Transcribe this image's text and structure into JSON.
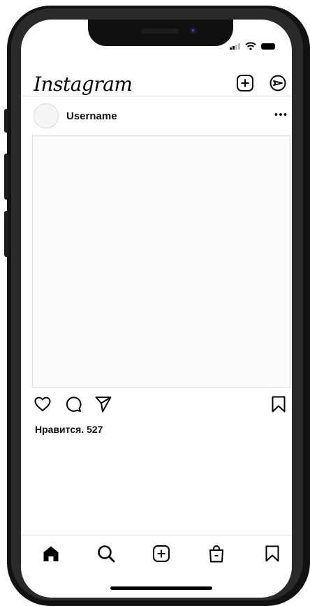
{
  "app": {
    "logo_text": "Instagram"
  },
  "header": {
    "icons": [
      "plus-square-icon",
      "direct-message-icon"
    ]
  },
  "post": {
    "username": "Username",
    "likes_text": "Нравится. 527"
  },
  "actions": {
    "icons": [
      "heart-icon",
      "comment-icon",
      "share-icon",
      "bookmark-icon"
    ]
  },
  "tabbar": {
    "items": [
      "home-icon",
      "search-icon",
      "add-icon",
      "shop-icon",
      "saved-icon"
    ]
  },
  "colors": {
    "background": "#ffffff",
    "text": "#111111",
    "frame": "#121212"
  }
}
